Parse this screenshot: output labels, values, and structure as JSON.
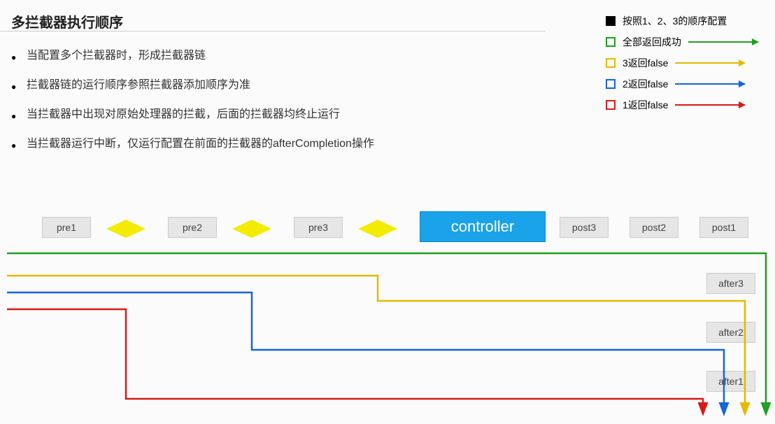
{
  "title": "多拦截器执行顺序",
  "bullets": [
    "当配置多个拦截器时，形成拦截器链",
    "拦截器链的运行顺序参照拦截器添加顺序为准",
    "当拦截器中出现对原始处理器的拦截，后面的拦截器均终止运行",
    "当拦截器运行中断，仅运行配置在前面的拦截器的afterCompletion操作"
  ],
  "legend": {
    "config": "按照1、2、3的顺序配置",
    "success": "全部返回成功",
    "ret3": "3返回false",
    "ret2": "2返回false",
    "ret1": "1返回false"
  },
  "nodes": {
    "pre1": "pre1",
    "pre2": "pre2",
    "pre3": "pre3",
    "controller": "controller",
    "post3": "post3",
    "post2": "post2",
    "post1": "post1",
    "after3": "after3",
    "after2": "after2",
    "after1": "after1"
  },
  "colors": {
    "green": "#1fa01f",
    "yellow": "#e6b800",
    "blue": "#1565d8",
    "red": "#d81a1a",
    "controllerBg": "#1aa3e8",
    "diamond": "#f3eb00"
  }
}
